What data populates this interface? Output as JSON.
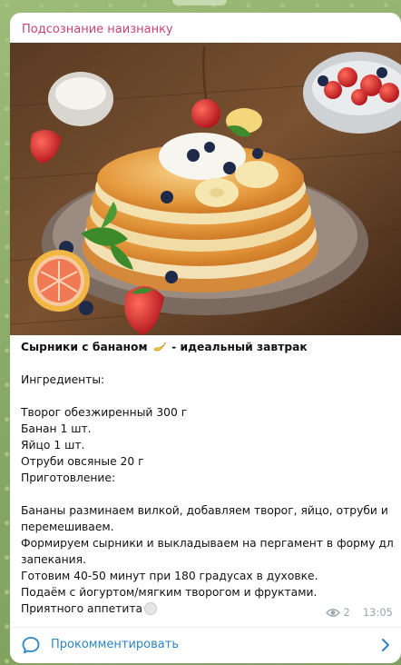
{
  "channel": {
    "name": "Подсознание наизнанку"
  },
  "post": {
    "title": "Сырники с бананом",
    "title_suffix": "- идеальный завтрак",
    "ingredients_heading": "Ингредиенты:",
    "ingredients": [
      "Творог обезжиренный 300 г",
      "Банан 1 шт.",
      "Яйцо 1 шт.",
      "Отруби овсяные 20 г"
    ],
    "preparation_heading": "Приготовление:",
    "steps": [
      "Бананы разминаем вилкой, добавляем творог, яйцо, отруби и",
      "перемешиваем.",
      "Формируем сырники и выкладываем на пергамент в форму для",
      "запекания.",
      "Готовим 40-50 минут при 180 градусах в духовке.",
      "Подаём с йогуртом/мягким творогом и фруктами."
    ],
    "closing": "Приятного аппетита",
    "closing_icon": "plate-emoji",
    "title_icon": "banana-emoji"
  },
  "meta": {
    "views": "2",
    "time": "13:05",
    "views_icon": "eye-icon"
  },
  "comment_bar": {
    "label": "Прокомментировать",
    "icon": "comment-icon",
    "chevron": "chevron-right-icon"
  },
  "colors": {
    "channel_name": "#c94173",
    "link": "#2a84c5",
    "meta": "#9aa5ae"
  }
}
